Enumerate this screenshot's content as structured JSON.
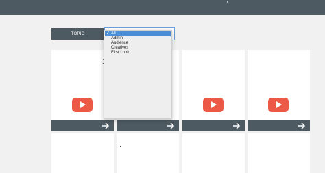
{
  "filter": {
    "label": "TOPIC",
    "options": [
      "All",
      "Admin",
      "Audience",
      "Creatives",
      "First Look"
    ],
    "selected": "All",
    "check_mark": "✓"
  },
  "stray_text": "1",
  "colors": {
    "header": "#4e5a62",
    "accent_play": "#ec5a47",
    "selection": "#4a8ed8"
  },
  "cards": [
    {
      "icon": "youtube-play-icon",
      "action_icon": "arrow-right-icon"
    },
    {
      "icon": "none",
      "action_icon": "arrow-right-icon"
    },
    {
      "icon": "youtube-play-icon",
      "action_icon": "arrow-right-icon"
    },
    {
      "icon": "youtube-play-icon",
      "action_icon": "arrow-right-icon"
    }
  ]
}
